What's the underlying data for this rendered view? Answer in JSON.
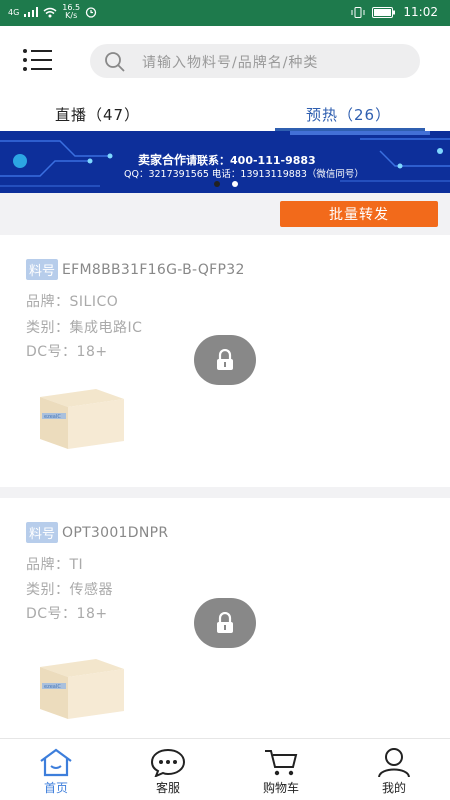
{
  "status_bar": {
    "network": "4G",
    "speed_value": "16.5",
    "speed_unit": "K/s",
    "time": "11:02"
  },
  "search": {
    "placeholder": "请输入物料号/品牌名/种类"
  },
  "tabs": [
    {
      "label": "直播（47）",
      "active": false
    },
    {
      "label": "预热（26）",
      "active": true
    }
  ],
  "banner": {
    "title": "卖家合作",
    "line1": "请联系：400-111-9883",
    "line2": "QQ：3217391565  电话：13913119883（微信同号）",
    "slide_count": 2,
    "active_slide": 2
  },
  "batch_button": "批量转发",
  "products": [
    {
      "part_tag": "料号",
      "part_number": "EFM8BB31F16G-B-QFP32",
      "brand": "品牌：SILICO",
      "category": "类别：集成电路IC",
      "dc": "DC号：18+"
    },
    {
      "part_tag": "料号",
      "part_number": "OPT3001DNPR",
      "brand": "品牌：TI",
      "category": "类别：传感器",
      "dc": "DC号：18+"
    }
  ],
  "bottom_nav": [
    {
      "label": "首页",
      "icon": "home-icon",
      "active": true
    },
    {
      "label": "客服",
      "icon": "chat-icon",
      "active": false
    },
    {
      "label": "购物车",
      "icon": "cart-icon",
      "active": false
    },
    {
      "label": "我的",
      "icon": "user-icon",
      "active": false
    }
  ],
  "colors": {
    "status_bar": "#1e7a4c",
    "accent_blue": "#2f5fb0",
    "batch_orange": "#f26a1b",
    "banner_blue": "#0d2f9a"
  }
}
